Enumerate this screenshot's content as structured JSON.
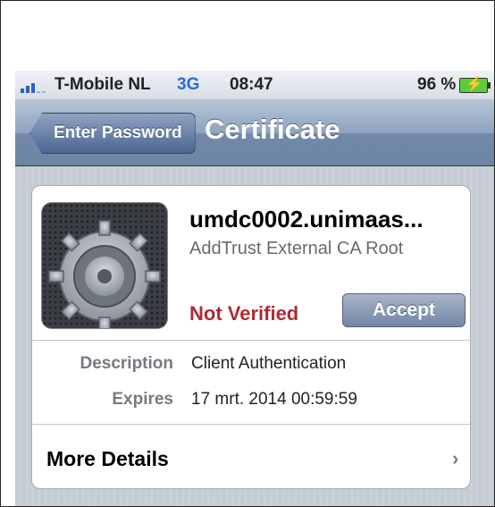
{
  "status_bar": {
    "carrier": "T-Mobile NL",
    "network": "3G",
    "time": "08:47",
    "battery_percent": "96 %",
    "signal_icon": "signal-bars-icon",
    "battery_icon": "battery-charging-icon"
  },
  "nav": {
    "back_label": "Enter Password",
    "title": "Certificate"
  },
  "certificate": {
    "name": "umdc0002.unimaas...",
    "issuer": "AddTrust External CA Root",
    "status": "Not Verified",
    "accept_label": "Accept",
    "icon": "gear-icon",
    "details": [
      {
        "label": "Description",
        "value": "Client Authentication"
      },
      {
        "label": "Expires",
        "value": "17 mrt. 2014 00:59:59"
      }
    ],
    "more_details_label": "More Details",
    "chevron": "›"
  },
  "colors": {
    "nav_bar": "#7d93b3",
    "status_red": "#b12a32",
    "network_blue": "#2d6ad8"
  }
}
